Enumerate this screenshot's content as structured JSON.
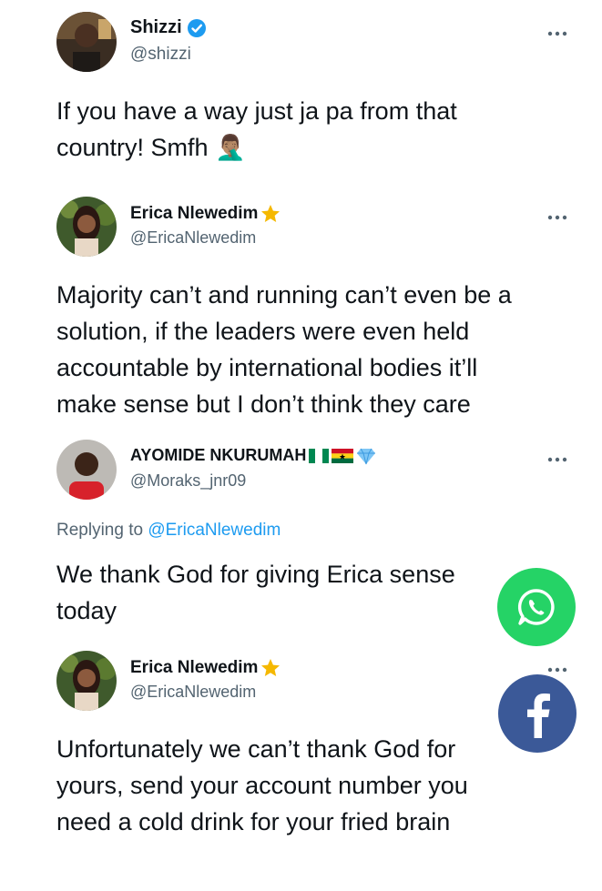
{
  "tweets": [
    {
      "name": "Shizzi",
      "handle": "@shizzi",
      "badge": "verified-badge-icon",
      "text_lines": [
        "If you have a way just ja pa from that",
        "country!  Smfh 🤦🏽‍♂️"
      ]
    },
    {
      "name": "Erica Nlewedim",
      "handle": "@EricaNlewedim",
      "badge": "star-icon",
      "text_lines": [
        "Majority can’t and running can’t even be a",
        "solution, if the leaders were even held",
        "accountable by international bodies it’ll",
        "make sense but I don’t think they care"
      ]
    },
    {
      "name": "AYOMIDE NKURUMAH",
      "handle": "@Moraks_jnr09",
      "badge": "flags-and-gem-icons",
      "replying_prefix": "Replying to ",
      "replying_to": "@EricaNlewedim",
      "text_lines": [
        "We thank God for giving Erica sense",
        "today"
      ]
    },
    {
      "name": "Erica Nlewedim",
      "handle": "@EricaNlewedim",
      "badge": "star-icon",
      "text_lines": [
        "Unfortunately we can’t thank God for",
        "yours, send your account number you",
        "need a cold drink for your fried brain"
      ]
    }
  ],
  "share_buttons": [
    {
      "icon": "whatsapp-icon",
      "color": "#25d366"
    },
    {
      "icon": "facebook-icon",
      "color": "#3b5998"
    }
  ],
  "colors": {
    "text": "#0f1419",
    "secondary": "#536471",
    "link": "#1d9bf0",
    "verified": "#1d9bf0",
    "star": "#f5b800"
  }
}
